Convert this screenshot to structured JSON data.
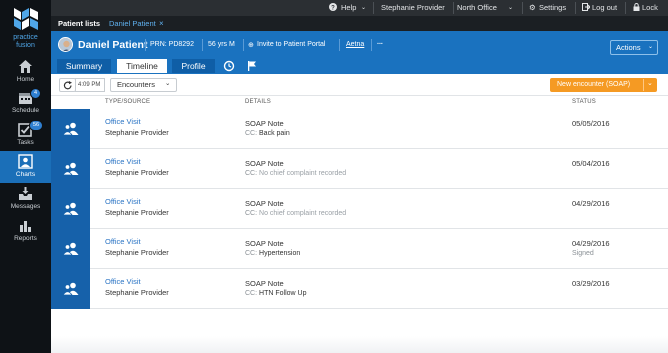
{
  "brand": {
    "line1": "practice",
    "line2": "fusion"
  },
  "nav": [
    {
      "id": "home",
      "label": "Home",
      "icon": "home-icon"
    },
    {
      "id": "schedule",
      "label": "Schedule",
      "icon": "calendar-icon",
      "badge": "4"
    },
    {
      "id": "tasks",
      "label": "Tasks",
      "icon": "tasks-icon",
      "badge": "56"
    },
    {
      "id": "charts",
      "label": "Charts",
      "icon": "person-icon",
      "active": true
    },
    {
      "id": "messages",
      "label": "Messages",
      "icon": "inbox-icon"
    },
    {
      "id": "reports",
      "label": "Reports",
      "icon": "bar-chart-icon"
    }
  ],
  "topbar": {
    "help": "Help",
    "provider": "Stephanie Provider",
    "office": "North Office",
    "settings": "Settings",
    "logout": "Log out",
    "lock": "Lock"
  },
  "tabs": {
    "patient_lists": "Patient lists",
    "active_patient": "Daniel Patient"
  },
  "patient": {
    "name": "Daniel Patient",
    "prn": "PRN: PD8292",
    "age": "56 yrs M",
    "invite": "Invite to Patient Portal",
    "insurance": "Aetna",
    "more": "...",
    "actions": "Actions"
  },
  "patient_tabs": {
    "summary": "Summary",
    "timeline": "Timeline",
    "profile": "Profile"
  },
  "toolbar": {
    "time": "4:09 PM",
    "filter": "Encounters",
    "new_encounter": "New encounter (SOAP)"
  },
  "columns": {
    "type": "TYPE/SOURCE",
    "details": "DETAILS",
    "status": "STATUS"
  },
  "encounters": [
    {
      "type": "Office Visit",
      "provider": "Stephanie Provider",
      "note": "SOAP Note",
      "cc_label": "CC:",
      "cc": "Back pain",
      "cc_muted": false,
      "date": "05/05/2016",
      "status": ""
    },
    {
      "type": "Office Visit",
      "provider": "Stephanie Provider",
      "note": "SOAP Note",
      "cc_label": "CC:",
      "cc": "No chief complaint recorded",
      "cc_muted": true,
      "date": "05/04/2016",
      "status": ""
    },
    {
      "type": "Office Visit",
      "provider": "Stephanie Provider",
      "note": "SOAP Note",
      "cc_label": "CC:",
      "cc": "No chief complaint recorded",
      "cc_muted": true,
      "date": "04/29/2016",
      "status": ""
    },
    {
      "type": "Office Visit",
      "provider": "Stephanie Provider",
      "note": "SOAP Note",
      "cc_label": "CC:",
      "cc": "Hypertension",
      "cc_muted": false,
      "date": "04/29/2016",
      "status": "Signed"
    },
    {
      "type": "Office Visit",
      "provider": "Stephanie Provider",
      "note": "SOAP Note",
      "cc_label": "CC:",
      "cc": "HTN Follow Up",
      "cc_muted": false,
      "date": "03/29/2016",
      "status": ""
    }
  ],
  "colors": {
    "nav_bg": "#0e1216",
    "nav_active": "#1b6fb8",
    "header_blue": "#1a72bf",
    "row_icon": "#1661aa",
    "link": "#2a74c4",
    "accent_orange": "#f59a23"
  }
}
